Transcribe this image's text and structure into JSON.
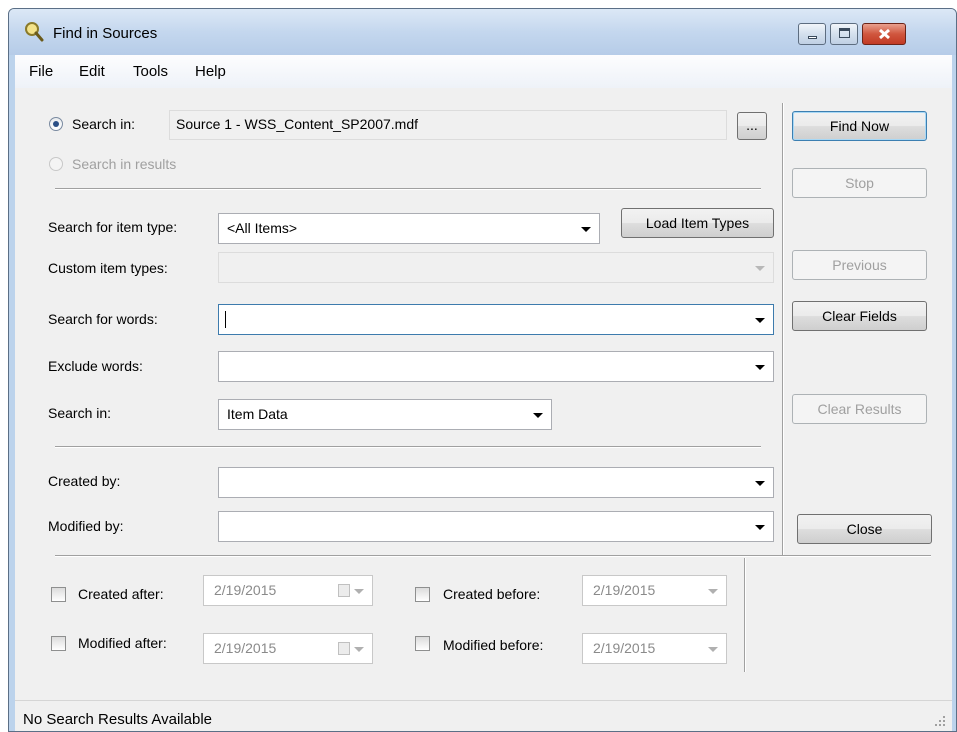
{
  "window": {
    "title": "Find in Sources"
  },
  "menu": [
    "File",
    "Edit",
    "Tools",
    "Help"
  ],
  "source": {
    "search_in_label": "Search in:",
    "source_value": "Source 1 - WSS_Content_SP2007.mdf",
    "browse_label": "...",
    "search_in_results_label": "Search in results"
  },
  "form": {
    "item_type_label": "Search for item type:",
    "item_type_value": "<All Items>",
    "load_item_types_label": "Load Item Types",
    "custom_item_types_label": "Custom item types:",
    "custom_item_types_value": "",
    "search_words_label": "Search for words:",
    "search_words_value": "",
    "exclude_words_label": "Exclude words:",
    "exclude_words_value": "",
    "search_in_label": "Search in:",
    "search_in_value": "Item Data",
    "created_by_label": "Created by:",
    "created_by_value": "",
    "modified_by_label": "Modified by:",
    "modified_by_value": ""
  },
  "dates": {
    "created_after_label": "Created after:",
    "created_after_value": "2/19/2015",
    "created_before_label": "Created before:",
    "created_before_value": "2/19/2015",
    "modified_after_label": "Modified after:",
    "modified_after_value": "2/19/2015",
    "modified_before_label": "Modified before:",
    "modified_before_value": "2/19/2015"
  },
  "buttons": {
    "find_now": "Find Now",
    "stop": "Stop",
    "previous": "Previous",
    "clear_fields": "Clear Fields",
    "clear_results": "Clear Results",
    "close": "Close"
  },
  "status": {
    "text": "No Search Results Available"
  }
}
